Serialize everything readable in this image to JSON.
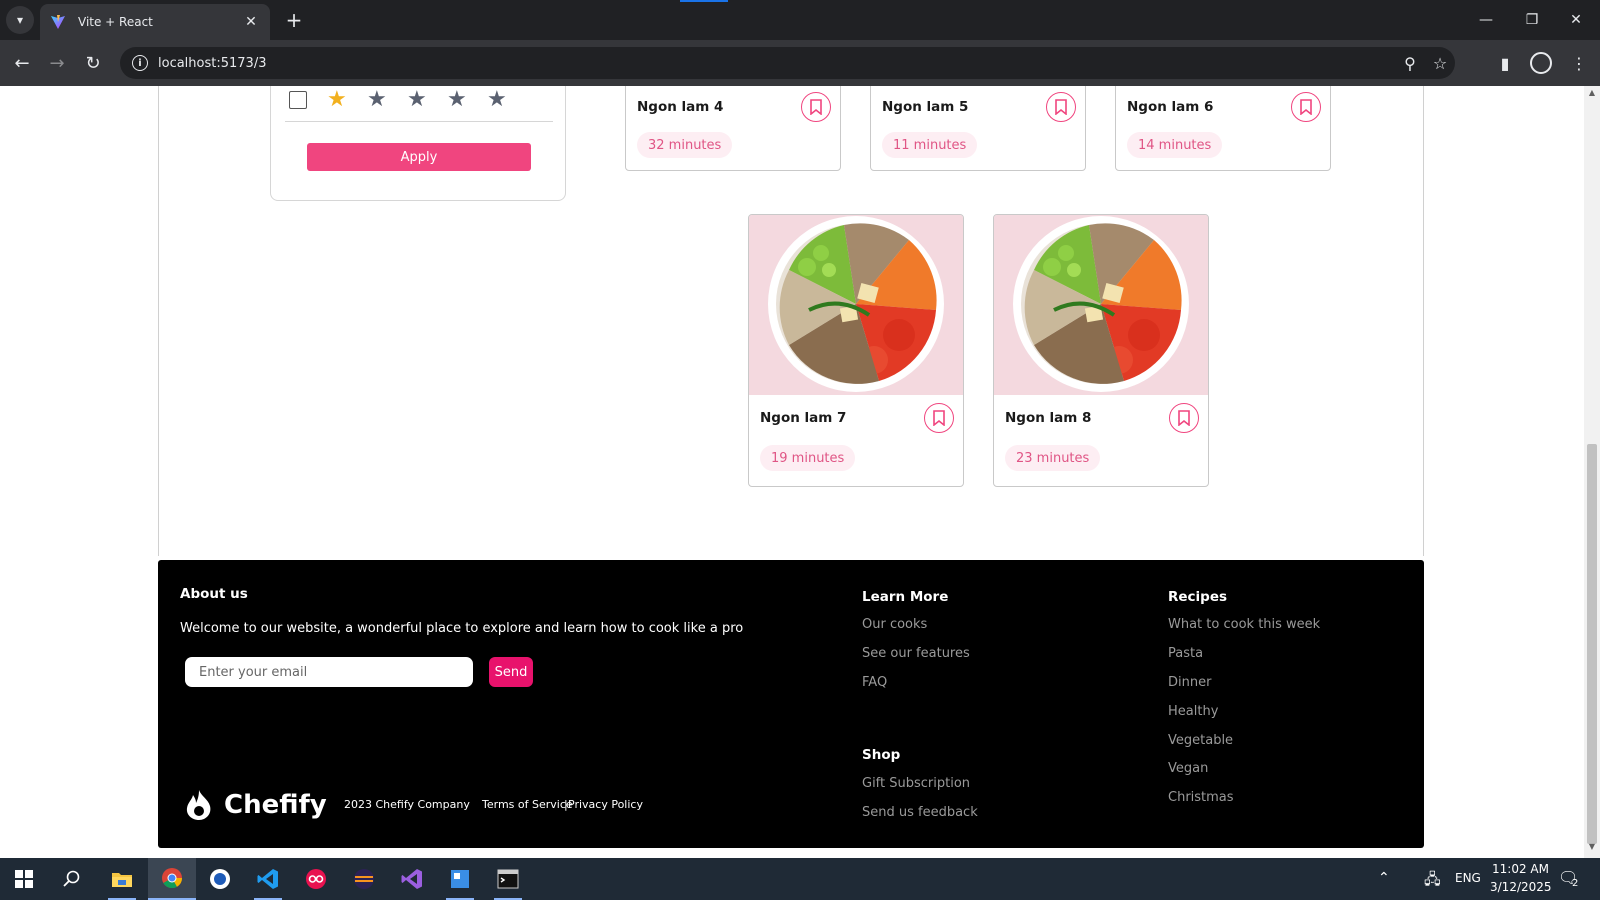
{
  "browser": {
    "tab_title": "Vite + React",
    "url": "localhost:5173/3"
  },
  "filter": {
    "rating_stars_total": 5,
    "rating_stars_filled": 1,
    "apply_label": "Apply"
  },
  "recipes_top": [
    {
      "name": "Ngon lam 4",
      "time": "32 minutes"
    },
    {
      "name": "Ngon lam 5",
      "time": "11 minutes"
    },
    {
      "name": "Ngon lam 6",
      "time": "14 minutes"
    }
  ],
  "recipes_bottom": [
    {
      "name": "Ngon lam 7",
      "time": "19 minutes"
    },
    {
      "name": "Ngon lam 8",
      "time": "23 minutes"
    }
  ],
  "footer": {
    "about_title": "About us",
    "about_text": "Welcome to our website, a wonderful place to explore and learn how to cook like a pro",
    "email_placeholder": "Enter your email",
    "send_label": "Send",
    "brand_name": "Chefify",
    "copyright": "2023 Chefify Company",
    "terms": "Terms of Service",
    "separator": "|",
    "privacy": "Privacy Policy",
    "learn_more": {
      "title": "Learn More",
      "links": [
        "Our cooks",
        "See our features",
        "FAQ"
      ]
    },
    "shop": {
      "title": "Shop",
      "links": [
        "Gift Subscription",
        "Send us feedback"
      ]
    },
    "recipes": {
      "title": "Recipes",
      "links": [
        "What to cook this week",
        "Pasta",
        "Dinner",
        "Healthy",
        "Vegetable",
        "Vegan",
        "Christmas"
      ]
    }
  },
  "taskbar": {
    "language": "ENG",
    "time": "11:02 AM",
    "date": "3/12/2025",
    "notification_count": "2"
  },
  "colors": {
    "accent": "#f0457f",
    "send": "#e8126c",
    "star_filled": "#f2b01e",
    "footer_bg": "#000000"
  }
}
